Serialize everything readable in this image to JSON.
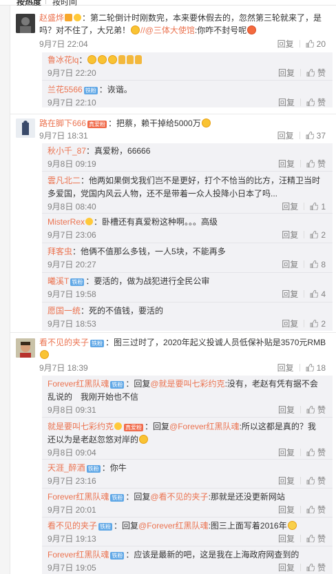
{
  "sort_tabs": [
    "按热度",
    "按时间"
  ],
  "icons": {
    "like": "thumbs-up-icon",
    "reply": "reply-link"
  },
  "colors": {
    "username": "#eb7350",
    "fans_badge": "#5fa7e6",
    "reply_box": "#f2f2f5"
  },
  "comments": [
    {
      "user": "赵盛烨",
      "text": "：第二轮倒计时刚数完，本来要休假去的，忽然第三轮就来了，是吗？对不住了，大兄弟！",
      "mention": "//@三体大使馆",
      "text_end": ":你咋不封号呢",
      "time": "9月7日 22:04",
      "reply_label": "回复",
      "likes": "20",
      "replies": [
        {
          "user": "鲁冰花lq",
          "text": "：",
          "time": "9月7日 22:20",
          "reply_label": "回复",
          "likes": "赞"
        },
        {
          "user": "兰花5566",
          "text": "：诙谐。",
          "time": "9月7日 22:10",
          "reply_label": "回复",
          "likes": "赞"
        }
      ]
    },
    {
      "user": "路在脚下666",
      "text": "：把蔡，赖干掉给5000万",
      "time": "9月7日 18:31",
      "reply_label": "回复",
      "likes": "37",
      "replies": [
        {
          "user": "秋小千_87",
          "text": "：真爱粉，66666",
          "time": "9月8日 09:19",
          "reply_label": "回复",
          "likes": "赞"
        },
        {
          "user": "雲凡北二",
          "text": "：他两如果倒戈我们岂不是更好，打个不恰当的比方，汪精卫当时多爱国，党国内风云人物，还不是带着一众人投降小日本了吗...",
          "time": "9月8日 08:40",
          "reply_label": "回复",
          "likes": "1"
        },
        {
          "user": "MisterRex",
          "text": "：卧槽还有真爱粉这种啊。。。高级",
          "time": "9月7日 23:06",
          "reply_label": "回复",
          "likes": "2"
        },
        {
          "user": "拜客虫",
          "text": "：他俩不值那么多钱，一人5块，不能再多",
          "time": "9月7日 20:27",
          "reply_label": "回复",
          "likes": "8"
        },
        {
          "user": "曦溪T",
          "text": "：要活的，做为战犯进行全民公审",
          "time": "9月7日 19:58",
          "reply_label": "回复",
          "likes": "4"
        },
        {
          "user": "愿国一统",
          "text": "：死的不值钱，要活的",
          "time": "9月7日 18:53",
          "reply_label": "回复",
          "likes": "2"
        }
      ]
    },
    {
      "user": "看不见的夹子",
      "text": "：图三过时了，2020年起义投诚人员低保补贴是3570元RMB",
      "time": "9月7日 18:39",
      "reply_label": "回复",
      "likes": "18",
      "replies": [
        {
          "user": "Forever红黑队魂",
          "pre": "：回复",
          "mention": "@就是要叫七彩约克",
          "text": ":没有，老赵有凭有据不会乱说的　我刚开始也不信",
          "time": "9月8日 09:31",
          "reply_label": "回复",
          "likes": "赞"
        },
        {
          "user": "就是要叫七彩约克",
          "pre": "：回复",
          "mention": "@Forever红黑队魂",
          "text": ":所以这都是真的？我还以为是老赵忽悠对岸的",
          "time": "9月8日 09:04",
          "reply_label": "回复",
          "likes": "赞"
        },
        {
          "user": "天涯_醉酒",
          "text": "：你牛",
          "time": "9月7日 23:16",
          "reply_label": "回复",
          "likes": "赞"
        },
        {
          "user": "Forever红黑队魂",
          "pre": "：回复",
          "mention": "@看不见的夹子",
          "text": ":那就是还没更新网站",
          "time": "9月7日 20:01",
          "reply_label": "回复",
          "likes": "赞"
        },
        {
          "user": "看不见的夹子",
          "pre": "：回复",
          "mention": "@Forever红黑队魂",
          "text": ":图三上面写着2016年",
          "time": "9月7日 19:13",
          "reply_label": "回复",
          "likes": "赞"
        },
        {
          "user": "Forever红黑队魂",
          "text": "：应该是最新的吧，这是我在上海政府网查到的",
          "time": "9月7日 19:05",
          "reply_label": "回复",
          "likes": "赞"
        }
      ]
    }
  ],
  "badges": {
    "fans": "铁粉",
    "star": "真爱粉"
  }
}
